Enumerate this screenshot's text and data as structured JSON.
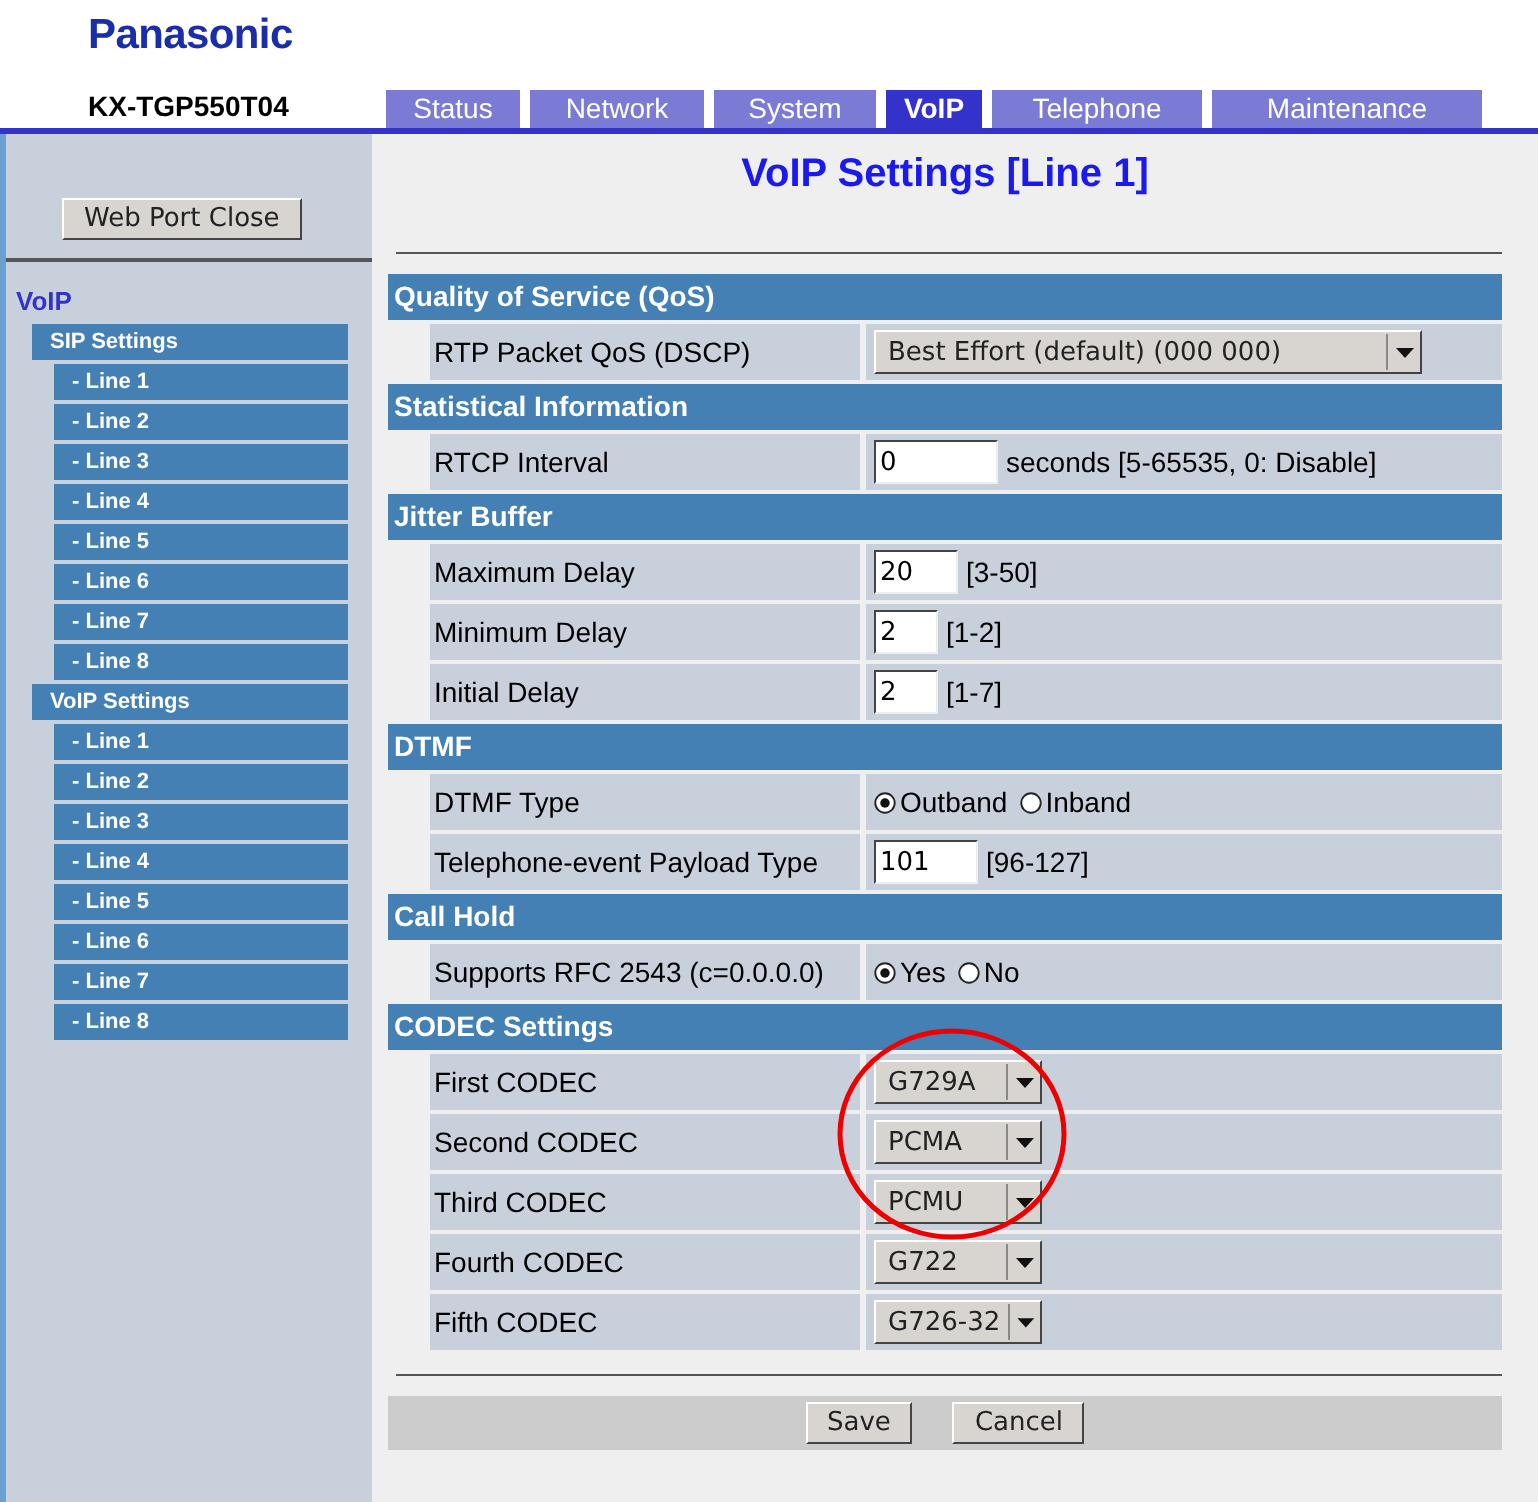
{
  "brand": "Panasonic",
  "model": "KX-TGP550T04",
  "tabs": [
    {
      "label": "Status",
      "selected": false
    },
    {
      "label": "Network",
      "selected": false
    },
    {
      "label": "System",
      "selected": false
    },
    {
      "label": "VoIP",
      "selected": true
    },
    {
      "label": "Telephone",
      "selected": false
    },
    {
      "label": "Maintenance",
      "selected": false
    }
  ],
  "sidebar": {
    "button": "Web Port Close",
    "heading": "VoIP",
    "groups": [
      {
        "label": "SIP Settings",
        "children": [
          {
            "label": "- Line 1"
          },
          {
            "label": "- Line 2"
          },
          {
            "label": "- Line 3"
          },
          {
            "label": "- Line 4"
          },
          {
            "label": "- Line 5"
          },
          {
            "label": "- Line 6"
          },
          {
            "label": "- Line 7"
          },
          {
            "label": "- Line 8"
          }
        ]
      },
      {
        "label": "VoIP Settings",
        "children": [
          {
            "label": "- Line 1"
          },
          {
            "label": "- Line 2"
          },
          {
            "label": "- Line 3"
          },
          {
            "label": "- Line 4"
          },
          {
            "label": "- Line 5"
          },
          {
            "label": "- Line 6"
          },
          {
            "label": "- Line 7"
          },
          {
            "label": "- Line 8"
          }
        ]
      }
    ]
  },
  "page_title": "VoIP Settings [Line 1]",
  "sections": [
    {
      "title": "Quality of Service (QoS)",
      "rows": [
        {
          "label": "RTP Packet QoS (DSCP)",
          "kind": "select",
          "value": "Best Effort (default) (000 000)"
        }
      ]
    },
    {
      "title": "Statistical Information",
      "rows": [
        {
          "label": "RTCP Interval",
          "kind": "input",
          "value": "0",
          "hint": "seconds [5-65535, 0: Disable]"
        }
      ]
    },
    {
      "title": "Jitter Buffer",
      "rows": [
        {
          "label": "Maximum Delay",
          "kind": "input",
          "value": "20",
          "hint": "[3-50]"
        },
        {
          "label": "Minimum Delay",
          "kind": "input",
          "value": "2",
          "hint": "[1-2]"
        },
        {
          "label": "Initial Delay",
          "kind": "input",
          "value": "2",
          "hint": "[1-7]"
        }
      ]
    },
    {
      "title": "DTMF",
      "rows": [
        {
          "label": "DTMF Type",
          "kind": "radio",
          "options": [
            {
              "label": "Outband",
              "selected": true
            },
            {
              "label": "Inband",
              "selected": false
            }
          ]
        },
        {
          "label": "Telephone-event Payload Type",
          "kind": "input",
          "value": "101",
          "hint": "[96-127]"
        }
      ]
    },
    {
      "title": "Call Hold",
      "rows": [
        {
          "label": "Supports RFC 2543 (c=0.0.0.0)",
          "kind": "radio",
          "options": [
            {
              "label": "Yes",
              "selected": true
            },
            {
              "label": "No",
              "selected": false
            }
          ]
        }
      ]
    },
    {
      "title": "CODEC Settings",
      "rows": [
        {
          "label": "First CODEC",
          "kind": "select",
          "value": "G729A"
        },
        {
          "label": "Second CODEC",
          "kind": "select",
          "value": "PCMA"
        },
        {
          "label": "Third CODEC",
          "kind": "select",
          "value": "PCMU"
        },
        {
          "label": "Fourth CODEC",
          "kind": "select",
          "value": "G722"
        },
        {
          "label": "Fifth CODEC",
          "kind": "select",
          "value": "G726-32"
        }
      ]
    }
  ],
  "buttons": [
    "Save",
    "Cancel"
  ]
}
